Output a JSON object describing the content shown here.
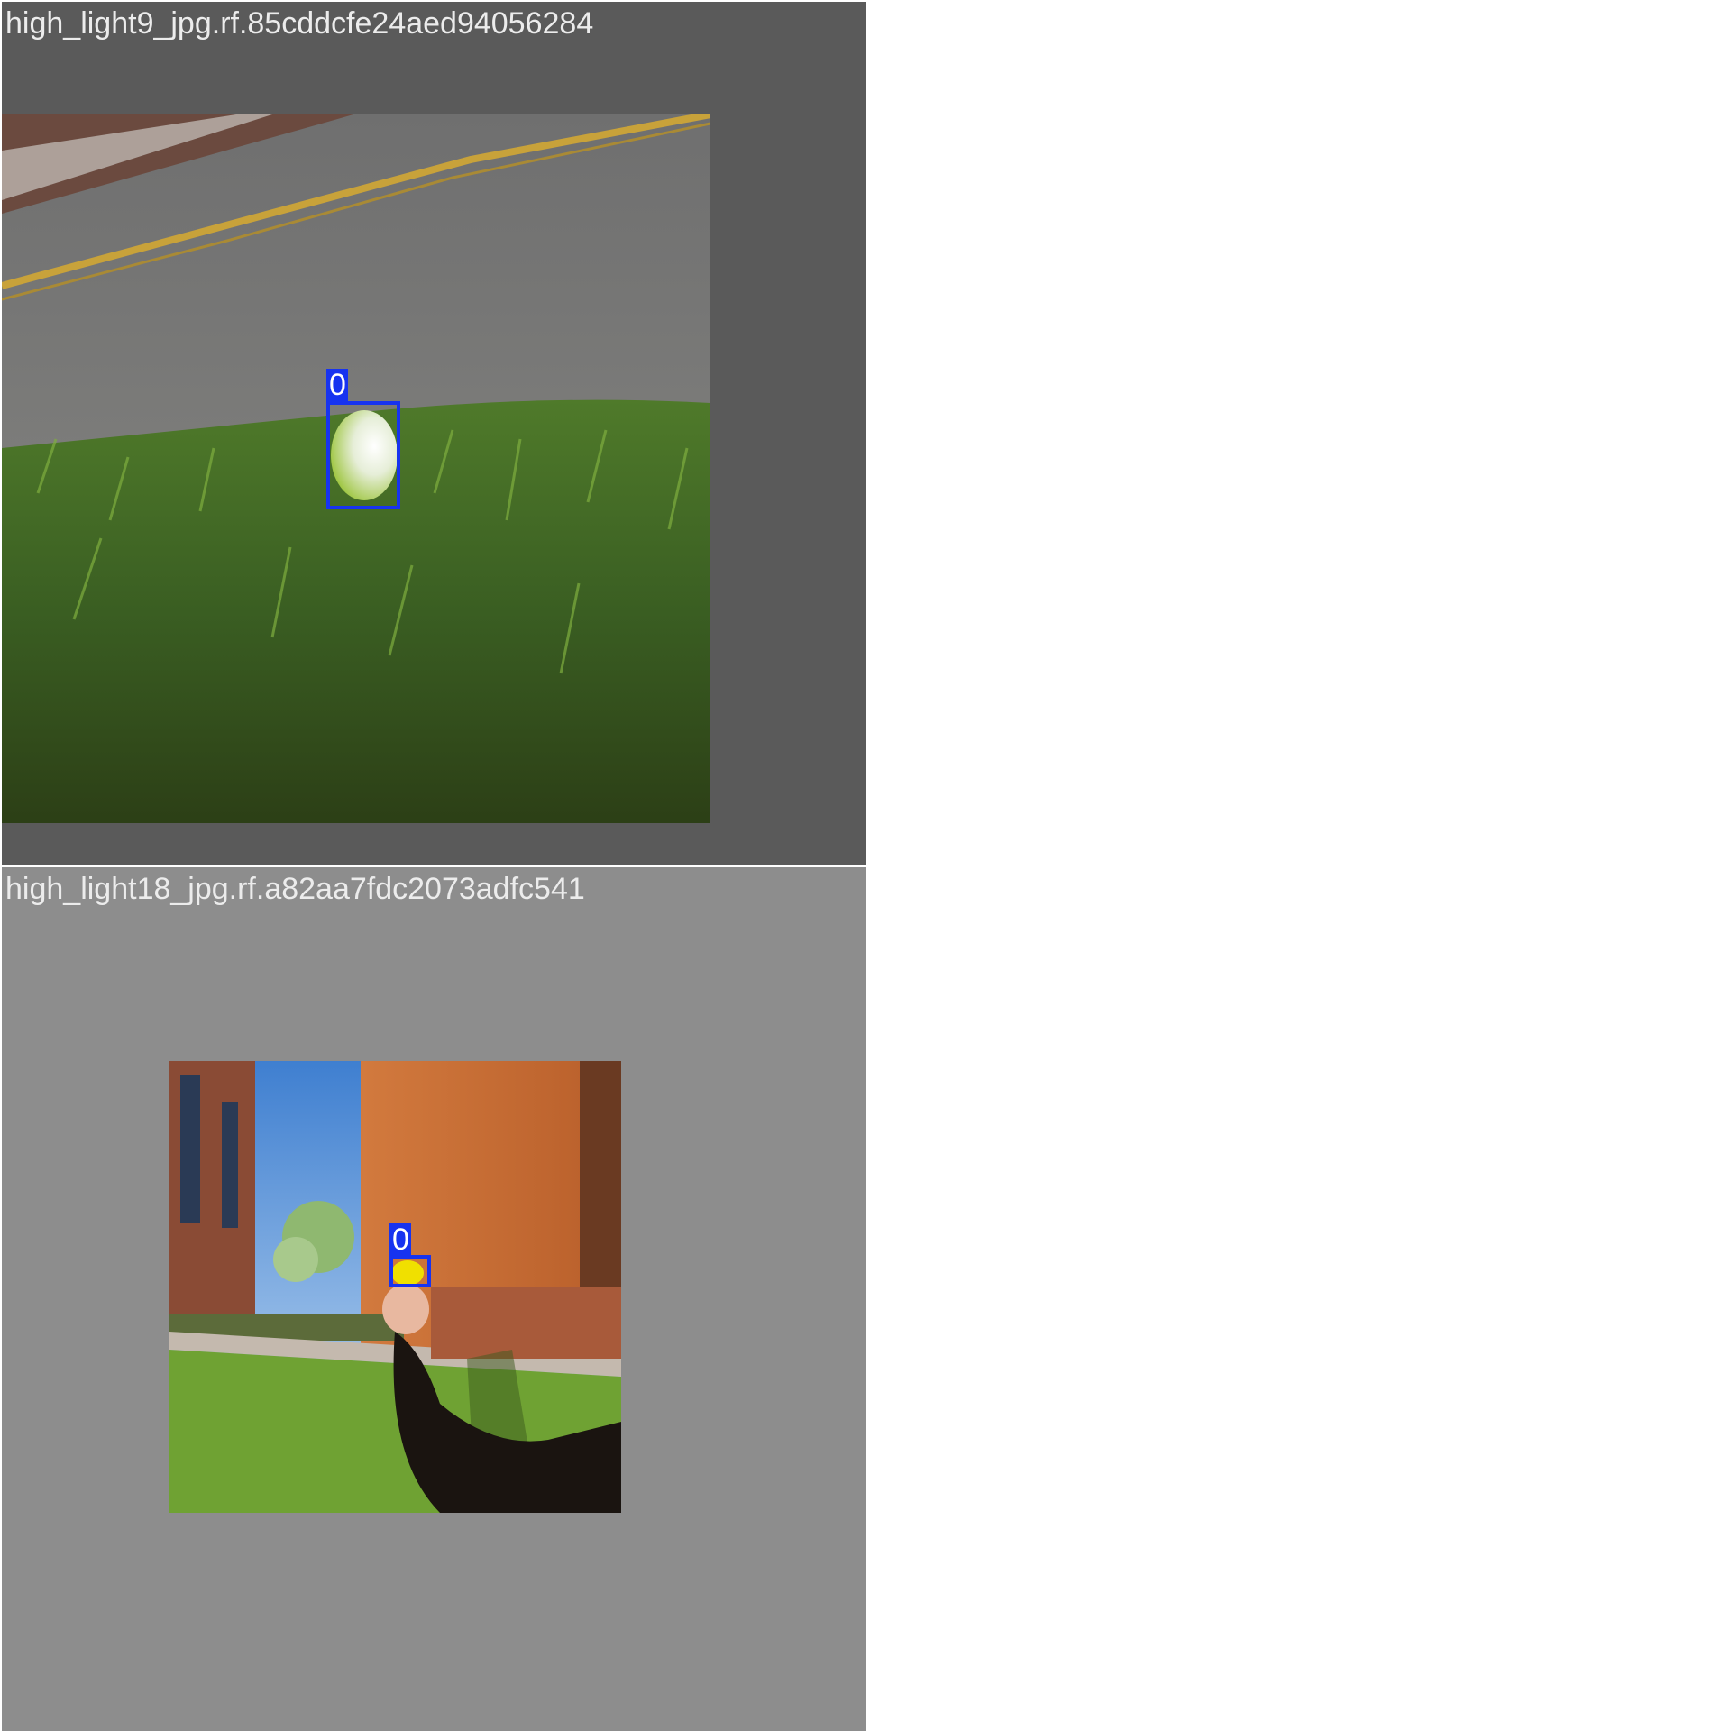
{
  "tiles": [
    {
      "title": "high_light9_jpg.rf.85cddcfe24aed94056284",
      "detections": [
        {
          "class_label": "0"
        }
      ]
    },
    {
      "title": "high_light18_jpg.rf.a82aa7fdc2073adfc541",
      "detections": [
        {
          "class_label": "0"
        }
      ]
    }
  ],
  "colors": {
    "bbox": "#1733f0",
    "tile1_background": "#5a5a5a",
    "tile2_background": "#8d8d8d",
    "title_text": "#ececec"
  }
}
